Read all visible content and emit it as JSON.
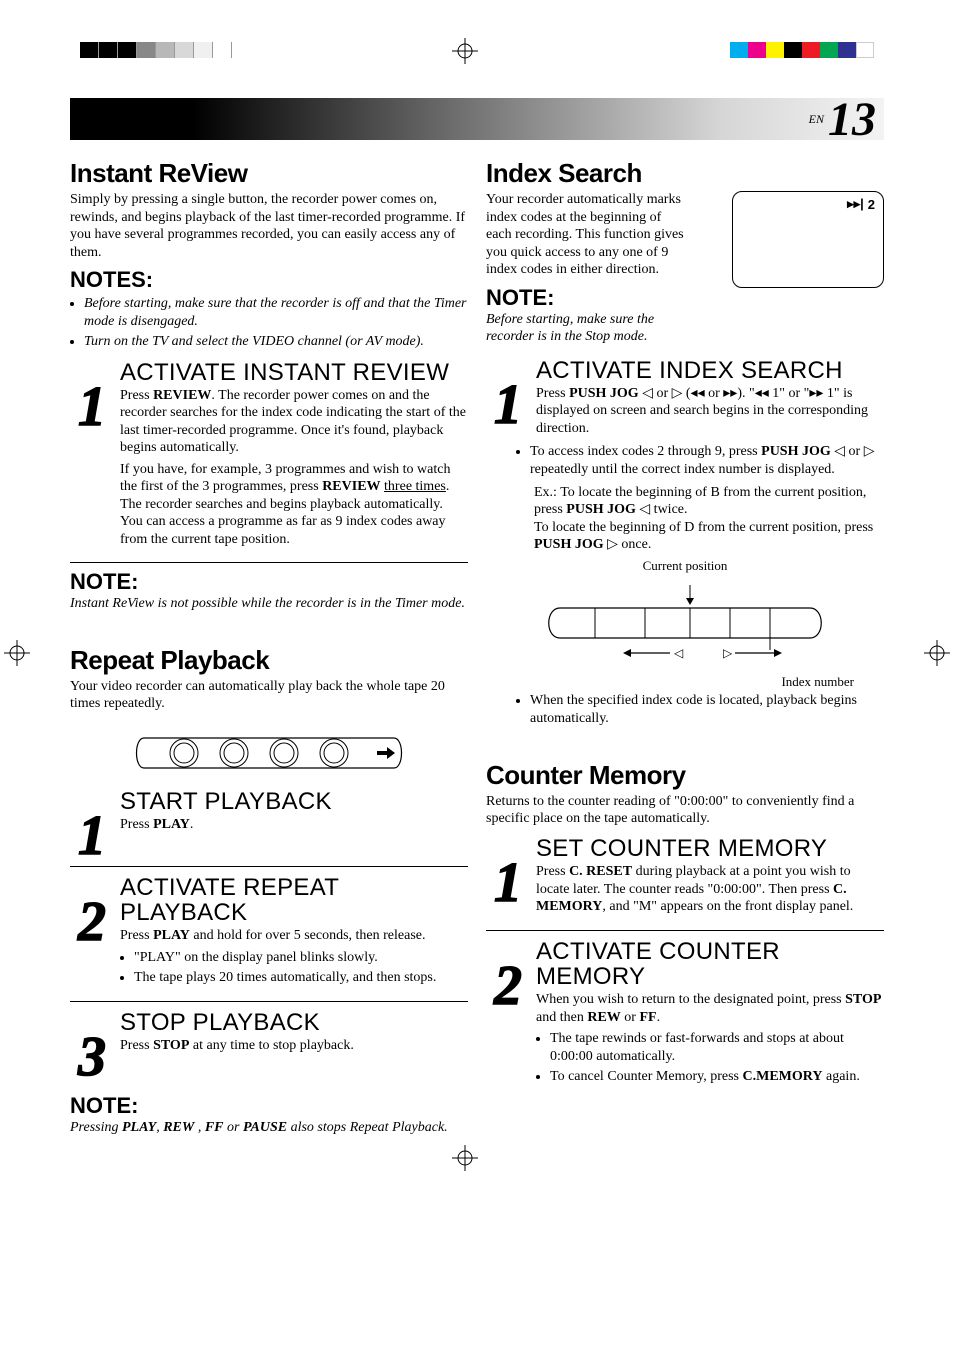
{
  "page": {
    "langTag": "EN",
    "pageNumber": "13"
  },
  "left": {
    "instantReview": {
      "title": "Instant ReView",
      "intro": "Simply by pressing a single button, the recorder power comes on, rewinds, and begins playback of the last timer-recorded programme. If you have several programmes recorded, you can easily access any of them.",
      "notesHeading": "NOTES:",
      "note1": "Before starting, make sure that the recorder is off and that the Timer mode is disengaged.",
      "note2": "Turn on the TV and select the VIDEO channel (or AV mode).",
      "step1Title": "ACTIVATE INSTANT REVIEW",
      "step1Para1a": "Press ",
      "step1Para1_review": "REVIEW",
      "step1Para1b": ". The recorder power comes on and the recorder searches for the index code indicating the start of the last timer-recorded programme. Once it's found, playback begins automatically.",
      "step1Para2a": "If you have, for example, 3 programmes and wish to watch the first of the 3 programmes, press ",
      "step1Para2_review": "REVIEW",
      "step1Para2b": " ",
      "step1Para2_three": "three times",
      "step1Para2c": ". The recorder searches and begins playback automatically. You can access a programme as far as 9 index codes away from the current tape position.",
      "noteHeading": "NOTE:",
      "noteText": "Instant ReView is not possible while the recorder is in the Timer mode."
    },
    "repeatPlayback": {
      "title": "Repeat Playback",
      "intro": "Your video recorder can automatically play back the whole tape 20 times repeatedly.",
      "step1Title": "START PLAYBACK",
      "step1Text_a": "Press ",
      "step1Text_b": "PLAY",
      "step1Text_c": ".",
      "step2Title": "ACTIVATE REPEAT PLAYBACK",
      "step2Text_a": "Press ",
      "step2Text_b": "PLAY",
      "step2Text_c": " and hold for over 5 seconds, then release.",
      "step2Bullet1": "\"PLAY\" on the display panel blinks slowly.",
      "step2Bullet2": "The tape plays 20 times automatically, and then stops.",
      "step3Title": "STOP PLAYBACK",
      "step3Text_a": "Press ",
      "step3Text_b": "STOP",
      "step3Text_c": " at any time to stop playback.",
      "noteHeading": "NOTE:",
      "noteText_a": "Pressing ",
      "noteText_b": "PLAY",
      "noteText_c": ", ",
      "noteText_d": "REW",
      "noteText_e": " , ",
      "noteText_f": "FF",
      "noteText_g": " or ",
      "noteText_h": "PAUSE",
      "noteText_i": " also stops Repeat Playback."
    }
  },
  "right": {
    "indexSearch": {
      "title": "Index Search",
      "intro": "Your recorder automatically marks index codes at the beginning of each recording. This function gives you quick access to any one of 9 index codes in either direction.",
      "displayValue": "2",
      "noteHeading": "NOTE:",
      "noteText": "Before starting, make sure the recorder is in the Stop mode.",
      "step1Title": "ACTIVATE INDEX SEARCH",
      "step1Text_a": "Press ",
      "step1Text_b": "PUSH JOG",
      "step1Text_c": " ◁ or ▷ (◂◂ or ▸▸). \"◂◂ 1\" or \"▸▸ 1\" is displayed on screen and search begins in the corresponding direction.",
      "bullet1_a": "To access index codes 2 through 9, press ",
      "bullet1_b": "PUSH JOG",
      "bullet1_c": " ◁ or ▷ repeatedly until the correct index number is displayed.",
      "ex_a": "Ex.: To locate the beginning of B from the current position, press  ",
      "ex_b": "PUSH JOG",
      "ex_c": " ◁ twice.",
      "ex_d": "To locate the beginning of D from the current position, press ",
      "ex_e": "PUSH JOG",
      "ex_f": " ▷ once.",
      "diagLabel1": "Current position",
      "diagLabel2": "Index number",
      "bullet2": "When the specified index code is located, playback begins automatically."
    },
    "counterMemory": {
      "title": "Counter Memory",
      "intro": "Returns to the counter reading of \"0:00:00\" to conveniently find a specific place on the tape automatically.",
      "step1Title": "SET COUNTER MEMORY",
      "step1_a": "Press ",
      "step1_b": "C. RESET",
      "step1_c": " during playback at a point you wish to locate later. The counter reads \"0:00:00\". Then press ",
      "step1_d": "C. MEMORY",
      "step1_e": ", and \"M\" appears on the front display panel.",
      "step2Title": "ACTIVATE COUNTER MEMORY",
      "step2_a": "When you wish to return to the designated point, press ",
      "step2_b": "STOP",
      "step2_c": " and then ",
      "step2_d": "REW",
      "step2_e": " or ",
      "step2_f": "FF",
      "step2_g": ".",
      "bullet1": "The tape rewinds or fast-forwards and stops at about 0:00:00 automatically.",
      "bullet2_a": "To cancel Counter Memory, press ",
      "bullet2_b": "C.MEMORY",
      "bullet2_c": " again."
    }
  }
}
